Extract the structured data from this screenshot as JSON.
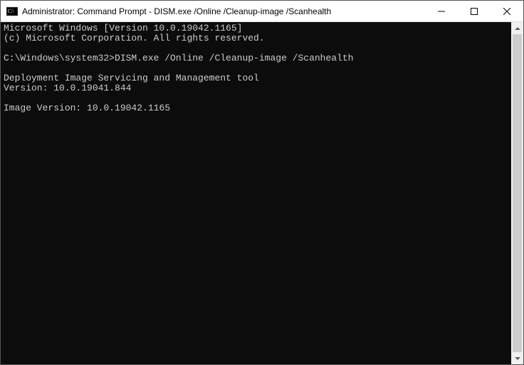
{
  "window": {
    "title": "Administrator: Command Prompt - DISM.exe /Online /Cleanup-image /Scanhealth"
  },
  "terminal": {
    "lines": [
      "Microsoft Windows [Version 10.0.19042.1165]",
      "(c) Microsoft Corporation. All rights reserved.",
      "",
      "C:\\Windows\\system32>DISM.exe /Online /Cleanup-image /Scanhealth",
      "",
      "Deployment Image Servicing and Management tool",
      "Version: 10.0.19041.844",
      "",
      "Image Version: 10.0.19042.1165"
    ]
  }
}
